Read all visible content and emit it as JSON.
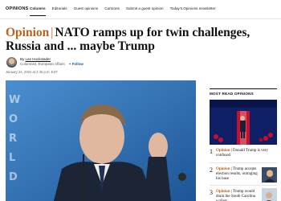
{
  "nav": {
    "section": "OPINIONS",
    "links": [
      "Columns",
      "Editorials",
      "Guest opinions",
      "Cartoons",
      "Submit a guest opinion",
      "Today's Opinions newsletter"
    ],
    "active_index": 0
  },
  "article": {
    "kicker": "Opinion",
    "divider": "|",
    "title": "NATO ramps up for twin challenges, Russia and ... maybe Trump",
    "author_prefix": "By ",
    "author": "Lee Hockstader",
    "author_role": "Columnist, European Affairs",
    "follow_label": "+ Follow",
    "date": "January 24, 2024 at 2:45 p.m. EST"
  },
  "sidebar": {
    "label": "MOST READ OPINIONS",
    "items": [
      {
        "num": "1",
        "kicker": "Opinion",
        "divider": " | ",
        "text": "Donald Trump is very confused"
      },
      {
        "num": "2",
        "kicker": "Opinion",
        "divider": " | ",
        "text": "Trump accepts election results, outraging his base"
      },
      {
        "num": "3",
        "kicker": "Opinion",
        "divider": " | ",
        "text": "Trump would drain the South Carolina wallets"
      }
    ]
  },
  "colors": {
    "kicker": "#b5651d",
    "follow": "#1a56a6",
    "photo_bg": "#2a6fb4"
  }
}
